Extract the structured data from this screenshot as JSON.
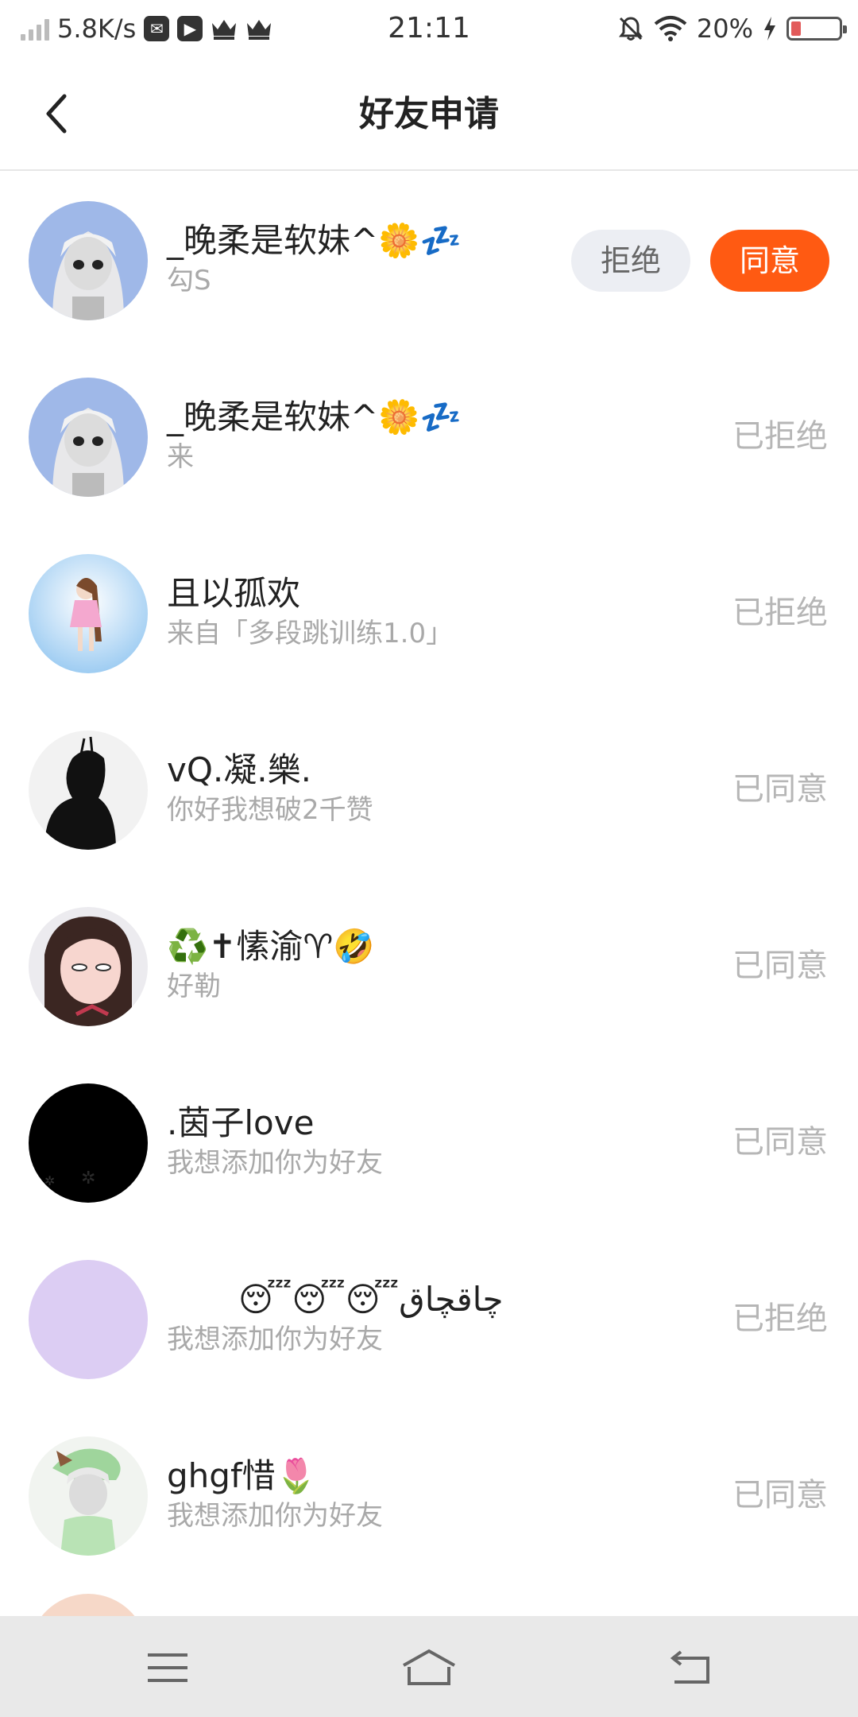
{
  "status_bar": {
    "net_speed": "5.8K/s",
    "time": "21:11",
    "battery_percent": "20%",
    "battery_level": 0.2,
    "icons": [
      "signal-icon",
      "message-app-icon",
      "video-app-icon",
      "crown-icon",
      "crown-icon",
      "mute-icon",
      "wifi-icon",
      "charging-icon",
      "battery-icon"
    ]
  },
  "nav": {
    "title": "好友申请",
    "back_icon": "chevron-left-icon"
  },
  "requests": [
    {
      "name": "_晚柔是软妹^🌼💤",
      "message": "勾S",
      "status": "",
      "actions": {
        "reject": "拒绝",
        "agree": "同意"
      }
    },
    {
      "name": "_晚柔是软妹^🌼💤",
      "message": "来",
      "status": "已拒绝"
    },
    {
      "name": "且以孤欢",
      "message": "来自「多段跳训练1.0」",
      "status": "已拒绝"
    },
    {
      "name": "vQ.凝.樂.",
      "message": "你好我想破2千赞",
      "status": "已同意"
    },
    {
      "name": "♻️✝愫渝♈🤣",
      "message": "好勒",
      "status": "已同意"
    },
    {
      "name": ".茵子love",
      "message": "我想添加你为好友",
      "status": "已同意"
    },
    {
      "name": "😴😴😴چاقچاق",
      "message": "我想添加你为好友",
      "status": "已拒绝"
    },
    {
      "name": "ghgf惜🌷",
      "message": "我想添加你为好友",
      "status": "已同意"
    }
  ],
  "colors": {
    "accent": "#ff5a12",
    "reject_bg": "#eceef3",
    "status_text": "#b6b6b6"
  },
  "system_nav": {
    "icons": [
      "menu-icon",
      "home-icon",
      "back-icon"
    ]
  }
}
